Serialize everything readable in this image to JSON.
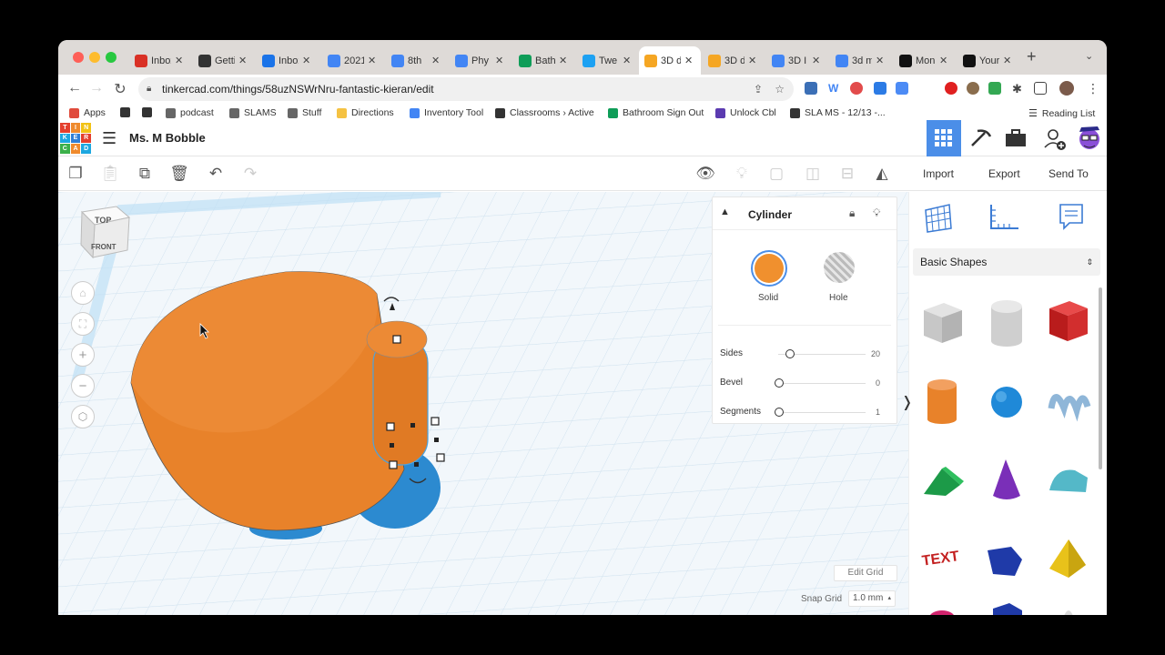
{
  "browser": {
    "tabs": [
      {
        "title": "Inbox",
        "color": "#d93025"
      },
      {
        "title": "Getti",
        "color": "#333333"
      },
      {
        "title": "Inbox",
        "color": "#1a73e8"
      },
      {
        "title": "2021",
        "color": "#4285f4"
      },
      {
        "title": "8th",
        "color": "#4285f4"
      },
      {
        "title": "Phy",
        "color": "#4285f4"
      },
      {
        "title": "Bath",
        "color": "#0f9d58"
      },
      {
        "title": "Twe",
        "color": "#1da1f2"
      },
      {
        "title": "3D d",
        "color": "#f5a623"
      },
      {
        "title": "3D d",
        "color": "#f5a623"
      },
      {
        "title": "3D I",
        "color": "#4285f4"
      },
      {
        "title": "3d m",
        "color": "#4285f4"
      },
      {
        "title": "Mon",
        "color": "#111111"
      },
      {
        "title": "Your",
        "color": "#111111"
      }
    ],
    "active_tab": 8,
    "url": "tinkercad.com/things/58uzNSWrNru-fantastic-kieran/edit",
    "bookmarks": [
      "Apps",
      "",
      "",
      "podcast",
      "SLAMS",
      "Stuff",
      "Directions",
      "Inventory Tool",
      "Classrooms › Active",
      "Bathroom Sign Out",
      "Unlock Cbl",
      "SLA MS - 12/13 -..."
    ],
    "reading_list": "Reading List"
  },
  "app": {
    "logo_letters": [
      "T",
      "I",
      "N",
      "K",
      "E",
      "R",
      "C",
      "A",
      "D"
    ],
    "design_name": "Ms. M Bobble",
    "toolbar": {
      "import": "Import",
      "export": "Export",
      "send_to": "Send To"
    }
  },
  "viewcube": {
    "top": "TOP",
    "front": "FRONT"
  },
  "inspector": {
    "title": "Cylinder",
    "solid_label": "Solid",
    "hole_label": "Hole",
    "solid_color": "#f0902e",
    "sliders": [
      {
        "label": "Sides",
        "value": "20"
      },
      {
        "label": "Bevel",
        "value": "0"
      },
      {
        "label": "Segments",
        "value": "1"
      }
    ]
  },
  "shapes_panel": {
    "category": "Basic Shapes"
  },
  "grid": {
    "edit_grid": "Edit Grid",
    "snap_label": "Snap Grid",
    "snap_value": "1.0 mm"
  }
}
